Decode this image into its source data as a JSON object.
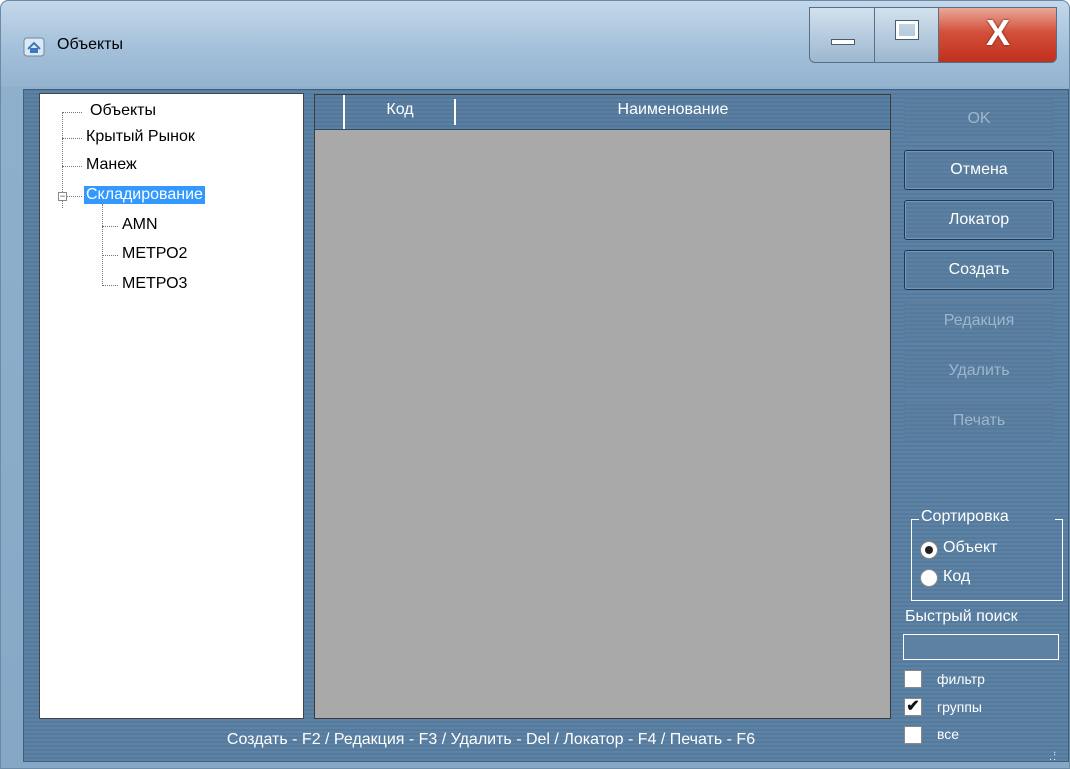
{
  "window": {
    "title": "Объекты",
    "close_glyph": "X"
  },
  "tree": {
    "items": [
      {
        "label": "Объекты",
        "level": 0
      },
      {
        "label": "Крытый Рынок",
        "level": 0
      },
      {
        "label": "Манеж",
        "level": 0
      },
      {
        "label": "Складирование",
        "level": 0,
        "expanded": true,
        "selected": true
      },
      {
        "label": "AMN",
        "level": 1
      },
      {
        "label": "МЕТРО2",
        "level": 1
      },
      {
        "label": "МЕТРО3",
        "level": 1
      }
    ]
  },
  "grid": {
    "columns": [
      "Код",
      "Наименование"
    ]
  },
  "buttons": [
    {
      "label": "OK",
      "enabled": false
    },
    {
      "label": "Отмена",
      "enabled": true
    },
    {
      "label": "Локатор",
      "enabled": true
    },
    {
      "label": "Создать",
      "enabled": true
    },
    {
      "label": "Редакция",
      "enabled": false
    },
    {
      "label": "Удалить",
      "enabled": false
    },
    {
      "label": "Печать",
      "enabled": false
    }
  ],
  "sort": {
    "legend": "Сортировка",
    "options": [
      {
        "label": "Объект",
        "selected": true
      },
      {
        "label": "Код",
        "selected": false
      }
    ]
  },
  "search": {
    "label": "Быстрый поиск",
    "value": ""
  },
  "checkboxes": [
    {
      "label": "фильтр",
      "checked": false
    },
    {
      "label": "группы",
      "checked": true
    },
    {
      "label": "все",
      "checked": false
    }
  ],
  "status": {
    "text": "Создать - F2 / Редакция - F3 / Удалить - Del / Локатор - F4 / Печать - F6"
  },
  "colors": {
    "selection": "#3399ff",
    "panel": "#5e82a4",
    "close_button": "#c8402a"
  }
}
